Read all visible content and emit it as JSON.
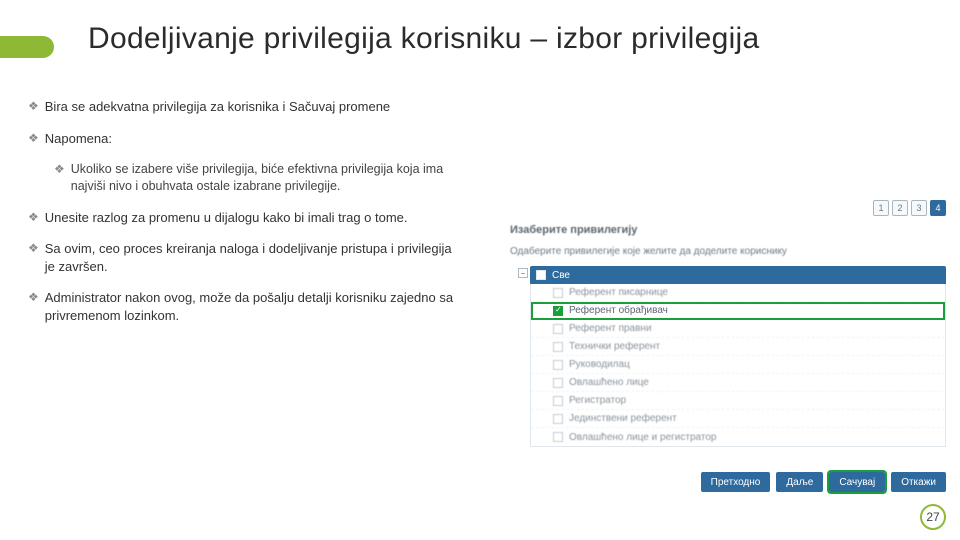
{
  "title": "Dodeljivanje privilegija korisniku – izbor privilegija",
  "bullets": {
    "b1": "Bira se adekvatna privilegija za korisnika i Sačuvaj promene",
    "b2": "Napomena:",
    "b2a": "Ukoliko se izabere više privilegija, biće efektivna privilegija koja ima najviši nivo i obuhvata ostale izabrane privilegije.",
    "b3": "Unesite razlog za promenu u dijalogu kako bi imali trag o tome.",
    "b4": "Sa ovim, ceo proces kreiranja naloga i dodeljivanje pristupa i privilegija je završen.",
    "b5": "Administrator nakon ovog, može da pošalju detalji korisniku zajedno sa privremenom lozinkom."
  },
  "shot": {
    "steps": [
      "1",
      "2",
      "3",
      "4"
    ],
    "active_step": 3,
    "panel_title": "Изаберите привилегију",
    "instruction": "Одаберите привилегије које желите да доделите кориснику",
    "root": "Све",
    "toggle": "−",
    "rows": [
      "Референт писарнице",
      "Референт обрађивач",
      "Референт правни",
      "Технички референт",
      "Руководилац",
      "Овлашћено лице",
      "Регистратор",
      "Јединствени референт",
      "Овлашћено лице и регистратор"
    ],
    "selected_index": 1,
    "buttons": {
      "prev": "Претходно",
      "next": "Даље",
      "save": "Сачувај",
      "cancel": "Откажи"
    }
  },
  "page_number": "27"
}
